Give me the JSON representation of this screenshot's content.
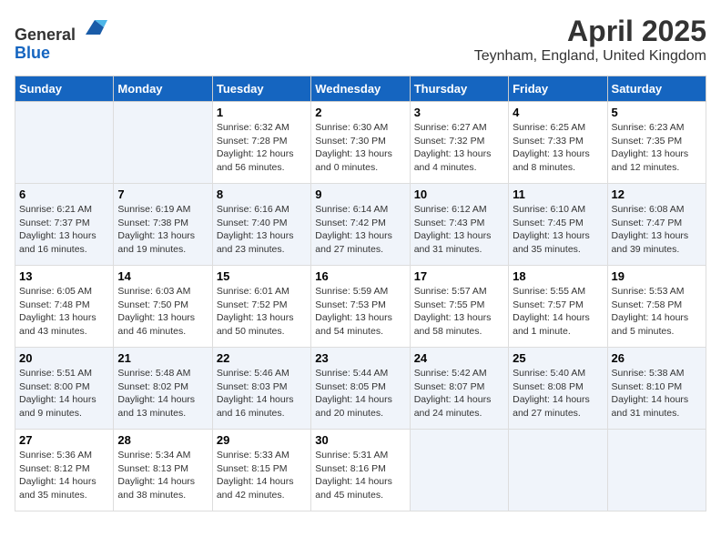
{
  "header": {
    "logo_general": "General",
    "logo_blue": "Blue",
    "title": "April 2025",
    "subtitle": "Teynham, England, United Kingdom"
  },
  "weekdays": [
    "Sunday",
    "Monday",
    "Tuesday",
    "Wednesday",
    "Thursday",
    "Friday",
    "Saturday"
  ],
  "weeks": [
    [
      {
        "day": "",
        "detail": ""
      },
      {
        "day": "",
        "detail": ""
      },
      {
        "day": "1",
        "detail": "Sunrise: 6:32 AM\nSunset: 7:28 PM\nDaylight: 12 hours and 56 minutes."
      },
      {
        "day": "2",
        "detail": "Sunrise: 6:30 AM\nSunset: 7:30 PM\nDaylight: 13 hours and 0 minutes."
      },
      {
        "day": "3",
        "detail": "Sunrise: 6:27 AM\nSunset: 7:32 PM\nDaylight: 13 hours and 4 minutes."
      },
      {
        "day": "4",
        "detail": "Sunrise: 6:25 AM\nSunset: 7:33 PM\nDaylight: 13 hours and 8 minutes."
      },
      {
        "day": "5",
        "detail": "Sunrise: 6:23 AM\nSunset: 7:35 PM\nDaylight: 13 hours and 12 minutes."
      }
    ],
    [
      {
        "day": "6",
        "detail": "Sunrise: 6:21 AM\nSunset: 7:37 PM\nDaylight: 13 hours and 16 minutes."
      },
      {
        "day": "7",
        "detail": "Sunrise: 6:19 AM\nSunset: 7:38 PM\nDaylight: 13 hours and 19 minutes."
      },
      {
        "day": "8",
        "detail": "Sunrise: 6:16 AM\nSunset: 7:40 PM\nDaylight: 13 hours and 23 minutes."
      },
      {
        "day": "9",
        "detail": "Sunrise: 6:14 AM\nSunset: 7:42 PM\nDaylight: 13 hours and 27 minutes."
      },
      {
        "day": "10",
        "detail": "Sunrise: 6:12 AM\nSunset: 7:43 PM\nDaylight: 13 hours and 31 minutes."
      },
      {
        "day": "11",
        "detail": "Sunrise: 6:10 AM\nSunset: 7:45 PM\nDaylight: 13 hours and 35 minutes."
      },
      {
        "day": "12",
        "detail": "Sunrise: 6:08 AM\nSunset: 7:47 PM\nDaylight: 13 hours and 39 minutes."
      }
    ],
    [
      {
        "day": "13",
        "detail": "Sunrise: 6:05 AM\nSunset: 7:48 PM\nDaylight: 13 hours and 43 minutes."
      },
      {
        "day": "14",
        "detail": "Sunrise: 6:03 AM\nSunset: 7:50 PM\nDaylight: 13 hours and 46 minutes."
      },
      {
        "day": "15",
        "detail": "Sunrise: 6:01 AM\nSunset: 7:52 PM\nDaylight: 13 hours and 50 minutes."
      },
      {
        "day": "16",
        "detail": "Sunrise: 5:59 AM\nSunset: 7:53 PM\nDaylight: 13 hours and 54 minutes."
      },
      {
        "day": "17",
        "detail": "Sunrise: 5:57 AM\nSunset: 7:55 PM\nDaylight: 13 hours and 58 minutes."
      },
      {
        "day": "18",
        "detail": "Sunrise: 5:55 AM\nSunset: 7:57 PM\nDaylight: 14 hours and 1 minute."
      },
      {
        "day": "19",
        "detail": "Sunrise: 5:53 AM\nSunset: 7:58 PM\nDaylight: 14 hours and 5 minutes."
      }
    ],
    [
      {
        "day": "20",
        "detail": "Sunrise: 5:51 AM\nSunset: 8:00 PM\nDaylight: 14 hours and 9 minutes."
      },
      {
        "day": "21",
        "detail": "Sunrise: 5:48 AM\nSunset: 8:02 PM\nDaylight: 14 hours and 13 minutes."
      },
      {
        "day": "22",
        "detail": "Sunrise: 5:46 AM\nSunset: 8:03 PM\nDaylight: 14 hours and 16 minutes."
      },
      {
        "day": "23",
        "detail": "Sunrise: 5:44 AM\nSunset: 8:05 PM\nDaylight: 14 hours and 20 minutes."
      },
      {
        "day": "24",
        "detail": "Sunrise: 5:42 AM\nSunset: 8:07 PM\nDaylight: 14 hours and 24 minutes."
      },
      {
        "day": "25",
        "detail": "Sunrise: 5:40 AM\nSunset: 8:08 PM\nDaylight: 14 hours and 27 minutes."
      },
      {
        "day": "26",
        "detail": "Sunrise: 5:38 AM\nSunset: 8:10 PM\nDaylight: 14 hours and 31 minutes."
      }
    ],
    [
      {
        "day": "27",
        "detail": "Sunrise: 5:36 AM\nSunset: 8:12 PM\nDaylight: 14 hours and 35 minutes."
      },
      {
        "day": "28",
        "detail": "Sunrise: 5:34 AM\nSunset: 8:13 PM\nDaylight: 14 hours and 38 minutes."
      },
      {
        "day": "29",
        "detail": "Sunrise: 5:33 AM\nSunset: 8:15 PM\nDaylight: 14 hours and 42 minutes."
      },
      {
        "day": "30",
        "detail": "Sunrise: 5:31 AM\nSunset: 8:16 PM\nDaylight: 14 hours and 45 minutes."
      },
      {
        "day": "",
        "detail": ""
      },
      {
        "day": "",
        "detail": ""
      },
      {
        "day": "",
        "detail": ""
      }
    ]
  ]
}
